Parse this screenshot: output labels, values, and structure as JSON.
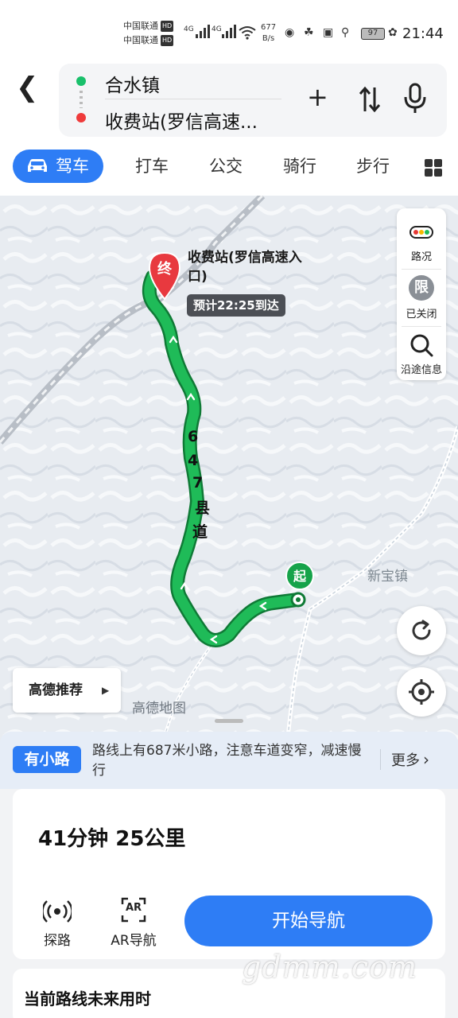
{
  "status_bar": {
    "carrier1": "中国联通",
    "carrier2": "中国联通",
    "hd": "HD",
    "net1": "4G",
    "net2": "4G",
    "speed_value": "677",
    "speed_unit": "B/s",
    "battery": "97",
    "time": "21:44"
  },
  "search": {
    "origin": "合水镇",
    "destination": "收费站(罗信高速...",
    "icons": [
      "back-icon",
      "add-icon",
      "swap-icon",
      "microphone-icon"
    ]
  },
  "modes": {
    "active": "驾车",
    "others": [
      "打车",
      "公交",
      "骑行",
      "步行"
    ]
  },
  "map": {
    "dest_name": "收费站(罗信高速入口)",
    "eta": "预计22:25到达",
    "dest_marker": "终",
    "start_marker": "起",
    "road_name_chars": [
      "6",
      "4",
      "7",
      "县",
      "道"
    ],
    "town": "新宝镇",
    "map_logo": "高德地图",
    "tools": {
      "traffic": "路况",
      "restriction_icon": "限",
      "restriction": "已关闭",
      "info": "沿途信息"
    },
    "recommend": "高德推荐",
    "route_color": "#1aa64b"
  },
  "notice": {
    "badge": "有小路",
    "text": "路线上有687米小路，注意车道变窄，减速慢行",
    "more": "更多"
  },
  "route_card": {
    "summary": "41分钟  25公里",
    "explore": "探路",
    "ar_icon_text": "AR",
    "ar": "AR导航",
    "start": "开始导航"
  },
  "bottom": {
    "future_time": "当前路线未来用时"
  },
  "watermark": "gdmm.com"
}
